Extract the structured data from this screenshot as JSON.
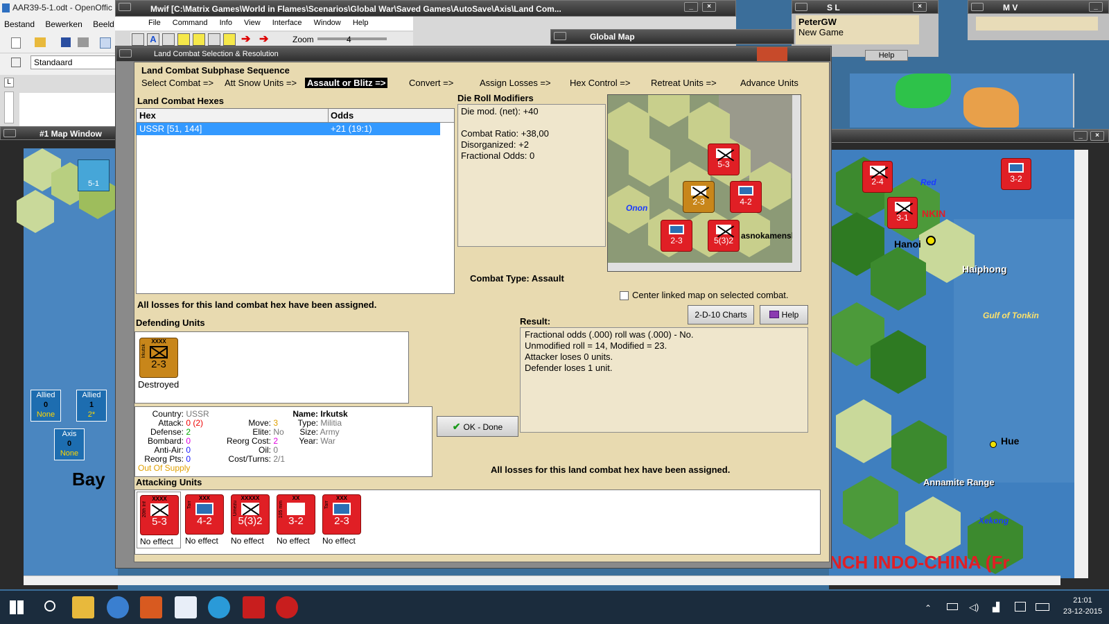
{
  "writer": {
    "title": "AAR39-5-1.odt - OpenOffic",
    "menu": [
      "Bestand",
      "Bewerken",
      "Beeld"
    ],
    "style": "Standaard"
  },
  "mwif": {
    "title": "Mwif [C:\\Matrix Games\\World in Flames\\Scenarios\\Global War\\Saved Games\\AutoSave\\Axis\\Land Com...",
    "menu": [
      "File",
      "Command",
      "Info",
      "View",
      "Interface",
      "Window",
      "Help"
    ],
    "zoom_label": "Zoom",
    "zoom_value": "4"
  },
  "sl": {
    "title": "S L",
    "player": "PeterGW",
    "game": "New Game"
  },
  "mv": {
    "title": "M V"
  },
  "global_map": {
    "title": "Global Map",
    "help": "Help"
  },
  "map1": {
    "title": "#1 Map Window",
    "boxes": [
      {
        "side": "Allied",
        "num": "0",
        "status": "None"
      },
      {
        "side": "Allied",
        "num": "1",
        "status": "2*"
      },
      {
        "side": "Axis",
        "num": "0",
        "status": "None"
      }
    ],
    "sea": "Bay"
  },
  "dialog": {
    "title": "Land Combat Selection & Resolution",
    "sequence_heading": "Land Combat Subphase Sequence",
    "sequence": [
      "Select Combat =>",
      "Att Snow Units =>",
      "Assault or Blitz =>",
      "Convert =>",
      "Assign Losses =>",
      "Hex Control =>",
      "Retreat Units =>",
      "Advance Units"
    ],
    "hexes_heading": "Land Combat Hexes",
    "hexes_cols": [
      "Hex",
      "Odds"
    ],
    "hexes_rows": [
      {
        "hex": "USSR [51, 144]",
        "odds": "+21 (19:1)"
      }
    ],
    "drm_heading": "Die Roll Modifiers",
    "drm_lines": [
      "Die mod. (net): +40",
      "",
      "Combat Ratio: +38,00",
      "Disorganized: +2",
      "Fractional Odds: 0"
    ],
    "combat_type": "Combat Type:  Assault",
    "center_map": "Center linked map on selected combat.",
    "charts_btn": "2-D-10 Charts",
    "help_btn": "Help",
    "losses_msg": "All losses for this land combat hex have been assigned.",
    "defending_heading": "Defending Units",
    "defender": {
      "top": "XXXX",
      "side": "Irkutsk",
      "val": "2-3",
      "status": "Destroyed"
    },
    "result_heading": "Result:",
    "result_lines": [
      "Fractional odds (.000) roll was (.000)  - No.",
      "Unmodified roll = 14, Modified = 23.",
      "Attacker loses 0 units.",
      "Defender loses 1 unit."
    ],
    "ok_btn": "OK - Done",
    "info_left": [
      {
        "k": "Country:",
        "v": "USSR"
      },
      {
        "k": "Attack:",
        "v": "0",
        "v2": "(2)"
      },
      {
        "k": "Defense:",
        "v": "2"
      },
      {
        "k": "Bombard:",
        "v": "0"
      },
      {
        "k": "Anti-Air:",
        "v": "0"
      },
      {
        "k": "Reorg Pts:",
        "v": "0"
      }
    ],
    "supply": "Out Of Supply",
    "info_mid": [
      {
        "k": "Move:",
        "v": "3"
      },
      {
        "k": "Elite:",
        "v": "No"
      },
      {
        "k": "Reorg Cost:",
        "v": "2"
      },
      {
        "k": "Oil:",
        "v": "0"
      },
      {
        "k": "Cost/Turns:",
        "v": "2/1"
      }
    ],
    "info_name_k": "Name:",
    "info_name_v": "Irkutsk",
    "info_right": [
      {
        "k": "Type:",
        "v": "Militia"
      },
      {
        "k": "Size:",
        "v": "Army"
      },
      {
        "k": "Year:",
        "v": "War"
      }
    ],
    "attacking_heading": "Attacking Units",
    "attackers": [
      {
        "top": "XXXX",
        "side": "20th Inf",
        "val": "5-3",
        "status": "No effect"
      },
      {
        "top": "XXX",
        "side": "Tarr",
        "val": "4-2",
        "status": "No effect"
      },
      {
        "top": "XXXXX",
        "side": "Umezu",
        "val": "5(3)2",
        "status": "No effect"
      },
      {
        "top": "XX",
        "side": "105 mm",
        "val": "3-2",
        "status": "No effect"
      },
      {
        "top": "XXX",
        "side": "Tarr",
        "val": "2-3",
        "status": "No effect"
      }
    ],
    "minimap": {
      "labels": [
        "Onon",
        "asnokamensl"
      ],
      "counters": [
        "5-3",
        "2-3",
        "4-2",
        "2-3",
        "5(3)2"
      ]
    }
  },
  "rightmap": {
    "labels": [
      "Hanoi",
      "Haiphong",
      "Gulf of Tonkin",
      "NKIN",
      "Hue",
      "Annamite Range",
      "Xekong",
      "NCH INDO-CHINA (Fr",
      "Red"
    ],
    "counters": [
      "2-4",
      "3-2",
      "3-1"
    ]
  },
  "taskbar": {
    "time": "21:01",
    "date": "23-12-2015"
  }
}
